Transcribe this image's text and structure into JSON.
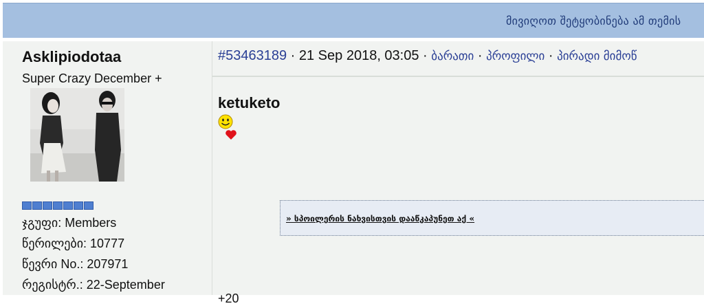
{
  "header": {
    "subscribe_text": "მივიღოთ შეტყობინება ამ თემის"
  },
  "author": {
    "username": "Asklipiodotaa",
    "title": "Super Crazy December +",
    "rank_pips": 7,
    "group": "ჯგუფი: Members",
    "posts": "წერილები: 10777",
    "member_no": "წევრი No.: 207971",
    "registered": "რეგისტრ.: 22-September"
  },
  "post": {
    "id": "#53463189",
    "date_sep": " · 21 Sep 2018, 03:05 · ",
    "links": {
      "card": "ბარათი",
      "profile": "პროფილი",
      "pm": "პირადი მიმოწ"
    },
    "dot": " · ",
    "title": "ketuketo",
    "smiley_icon": "smiley-face-icon",
    "heart_icon": "heart-icon",
    "spoiler_text": "» სპოილერის ნახვისთვის დააწკაპუნეთ აქ «",
    "bottom_partial": "+20"
  },
  "colors": {
    "header_bg": "#a4bfe0",
    "panel_bg": "#f1f3f1",
    "link": "#2a3f95",
    "pip": "#4f7fd0"
  }
}
